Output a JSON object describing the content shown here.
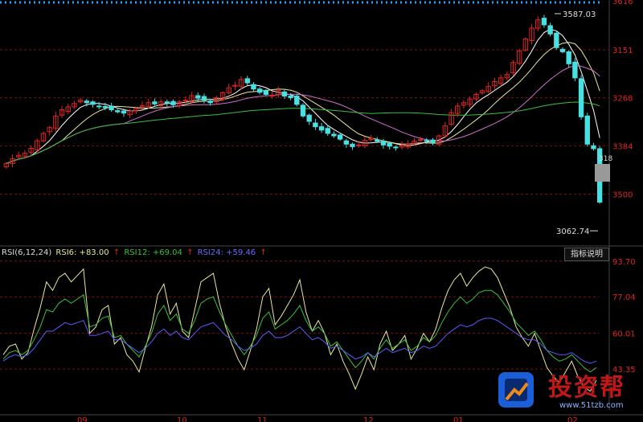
{
  "price_panel": {
    "y_ticks": [
      "3500",
      "3384",
      "3268",
      "3151"
    ],
    "partial_top_tick": "3616",
    "high_label": "3587.03",
    "low_label": "3062.74",
    "cursor_label": "318"
  },
  "rsi_panel": {
    "title": "RSI(6,12,24)",
    "rsi6": "RSI6: +83.00",
    "rsi12": "RSI12: +69.04",
    "rsi24": "RSI24: +59.46",
    "explain_button": "指标说明",
    "y_ticks": [
      "93.70",
      "77.04",
      "60.01",
      "43.35"
    ]
  },
  "x_axis": {
    "labels": [
      "09",
      "10",
      "11",
      "12",
      "01",
      "02"
    ]
  },
  "watermark": {
    "text": "投资帮",
    "url": "www.51tzb.com"
  },
  "colors": {
    "rsi6": "#e8e89a",
    "rsi12": "#3cbf3c",
    "rsi24": "#5b5bff",
    "up": "#e02424",
    "down": "#48e0e0",
    "axis_text": "#e02424",
    "grid": "#7a1010",
    "ma5": "#ffffff",
    "ma10": "#e8e89a",
    "ma20": "#d070d0",
    "ma60": "#3cbf3c"
  },
  "chart_data": [
    {
      "type": "candlestick",
      "title": "",
      "ylim": [
        3030,
        3620
      ],
      "y_ticks": [
        3151,
        3268,
        3384,
        3500
      ],
      "annotations": [
        {
          "label": "3587.03",
          "value": 3587.03
        },
        {
          "label": "3062.74",
          "value": 3062.74
        }
      ],
      "series_moving_averages": [
        "MA5",
        "MA10",
        "MA20",
        "MA60"
      ],
      "close": [
        3225,
        3237,
        3245,
        3250,
        3262,
        3280,
        3298,
        3312,
        3340,
        3355,
        3362,
        3370,
        3378,
        3372,
        3368,
        3363,
        3360,
        3355,
        3350,
        3347,
        3352,
        3358,
        3365,
        3372,
        3369,
        3374,
        3371,
        3367,
        3375,
        3378,
        3389,
        3383,
        3378,
        3372,
        3384,
        3396,
        3408,
        3414,
        3428,
        3420,
        3405,
        3397,
        3392,
        3390,
        3402,
        3388,
        3384,
        3368,
        3340,
        3327,
        3314,
        3306,
        3298,
        3292,
        3284,
        3272,
        3266,
        3270,
        3281,
        3286,
        3279,
        3270,
        3267,
        3263,
        3269,
        3273,
        3279,
        3283,
        3280,
        3276,
        3292,
        3316,
        3348,
        3364,
        3372,
        3381,
        3392,
        3401,
        3411,
        3423,
        3432,
        3440,
        3469,
        3497,
        3526,
        3552,
        3572,
        3560,
        3538,
        3505,
        3495,
        3466,
        3432,
        3338,
        3272,
        3261,
        3132
      ]
    },
    {
      "type": "line",
      "title": "RSI(6,12,24)",
      "ylim": [
        28,
        97
      ],
      "y_ticks": [
        43.35,
        60.01,
        77.04,
        93.7
      ],
      "series": [
        {
          "name": "RSI6",
          "current": 83.0,
          "values": [
            50,
            54,
            55,
            48,
            51,
            62,
            72,
            84,
            80,
            86,
            88,
            84,
            87,
            90,
            60,
            63,
            71,
            73,
            55,
            58,
            50,
            47,
            42,
            53,
            63,
            78,
            83,
            69,
            74,
            61,
            58,
            71,
            84,
            86,
            88,
            74,
            63,
            55,
            48,
            43,
            52,
            62,
            77,
            81,
            64,
            68,
            73,
            78,
            85,
            70,
            61,
            66,
            60,
            50,
            55,
            47,
            41,
            34,
            41,
            49,
            43,
            55,
            61,
            52,
            55,
            59,
            48,
            53,
            60,
            56,
            62,
            72,
            80,
            85,
            88,
            82,
            86,
            89,
            91,
            90,
            86,
            79,
            72,
            63,
            58,
            54,
            60,
            52,
            44,
            40,
            37,
            42,
            47,
            40,
            35,
            33,
            38
          ]
        },
        {
          "name": "RSI12",
          "current": 69.04,
          "values": [
            48,
            51,
            52,
            50,
            52,
            57,
            63,
            71,
            70,
            74,
            76,
            74,
            76,
            78,
            63,
            64,
            67,
            68,
            58,
            59,
            55,
            52,
            49,
            54,
            60,
            69,
            73,
            66,
            69,
            62,
            60,
            66,
            74,
            76,
            77,
            70,
            64,
            59,
            54,
            50,
            54,
            59,
            67,
            70,
            62,
            64,
            66,
            69,
            73,
            66,
            61,
            63,
            60,
            54,
            56,
            52,
            48,
            44,
            47,
            51,
            48,
            53,
            57,
            53,
            55,
            57,
            52,
            54,
            58,
            56,
            59,
            65,
            70,
            74,
            77,
            74,
            76,
            79,
            80,
            80,
            78,
            74,
            70,
            65,
            62,
            59,
            61,
            57,
            52,
            49,
            47,
            48,
            50,
            47,
            44,
            42,
            44
          ]
        },
        {
          "name": "RSI24",
          "current": 59.46,
          "values": [
            47,
            49,
            50,
            49,
            50,
            53,
            57,
            61,
            61,
            63,
            65,
            64,
            65,
            66,
            59,
            59,
            60,
            61,
            57,
            57,
            55,
            53,
            51,
            53,
            56,
            60,
            62,
            59,
            61,
            58,
            57,
            60,
            63,
            64,
            65,
            62,
            59,
            57,
            54,
            52,
            53,
            55,
            59,
            61,
            58,
            58,
            59,
            61,
            63,
            60,
            57,
            58,
            56,
            53,
            54,
            52,
            50,
            48,
            49,
            51,
            49,
            51,
            53,
            51,
            52,
            53,
            51,
            52,
            54,
            53,
            54,
            57,
            60,
            62,
            64,
            63,
            64,
            66,
            67,
            67,
            66,
            64,
            62,
            60,
            58,
            57,
            57,
            55,
            52,
            51,
            50,
            50,
            51,
            49,
            47,
            46,
            47
          ]
        }
      ]
    }
  ]
}
